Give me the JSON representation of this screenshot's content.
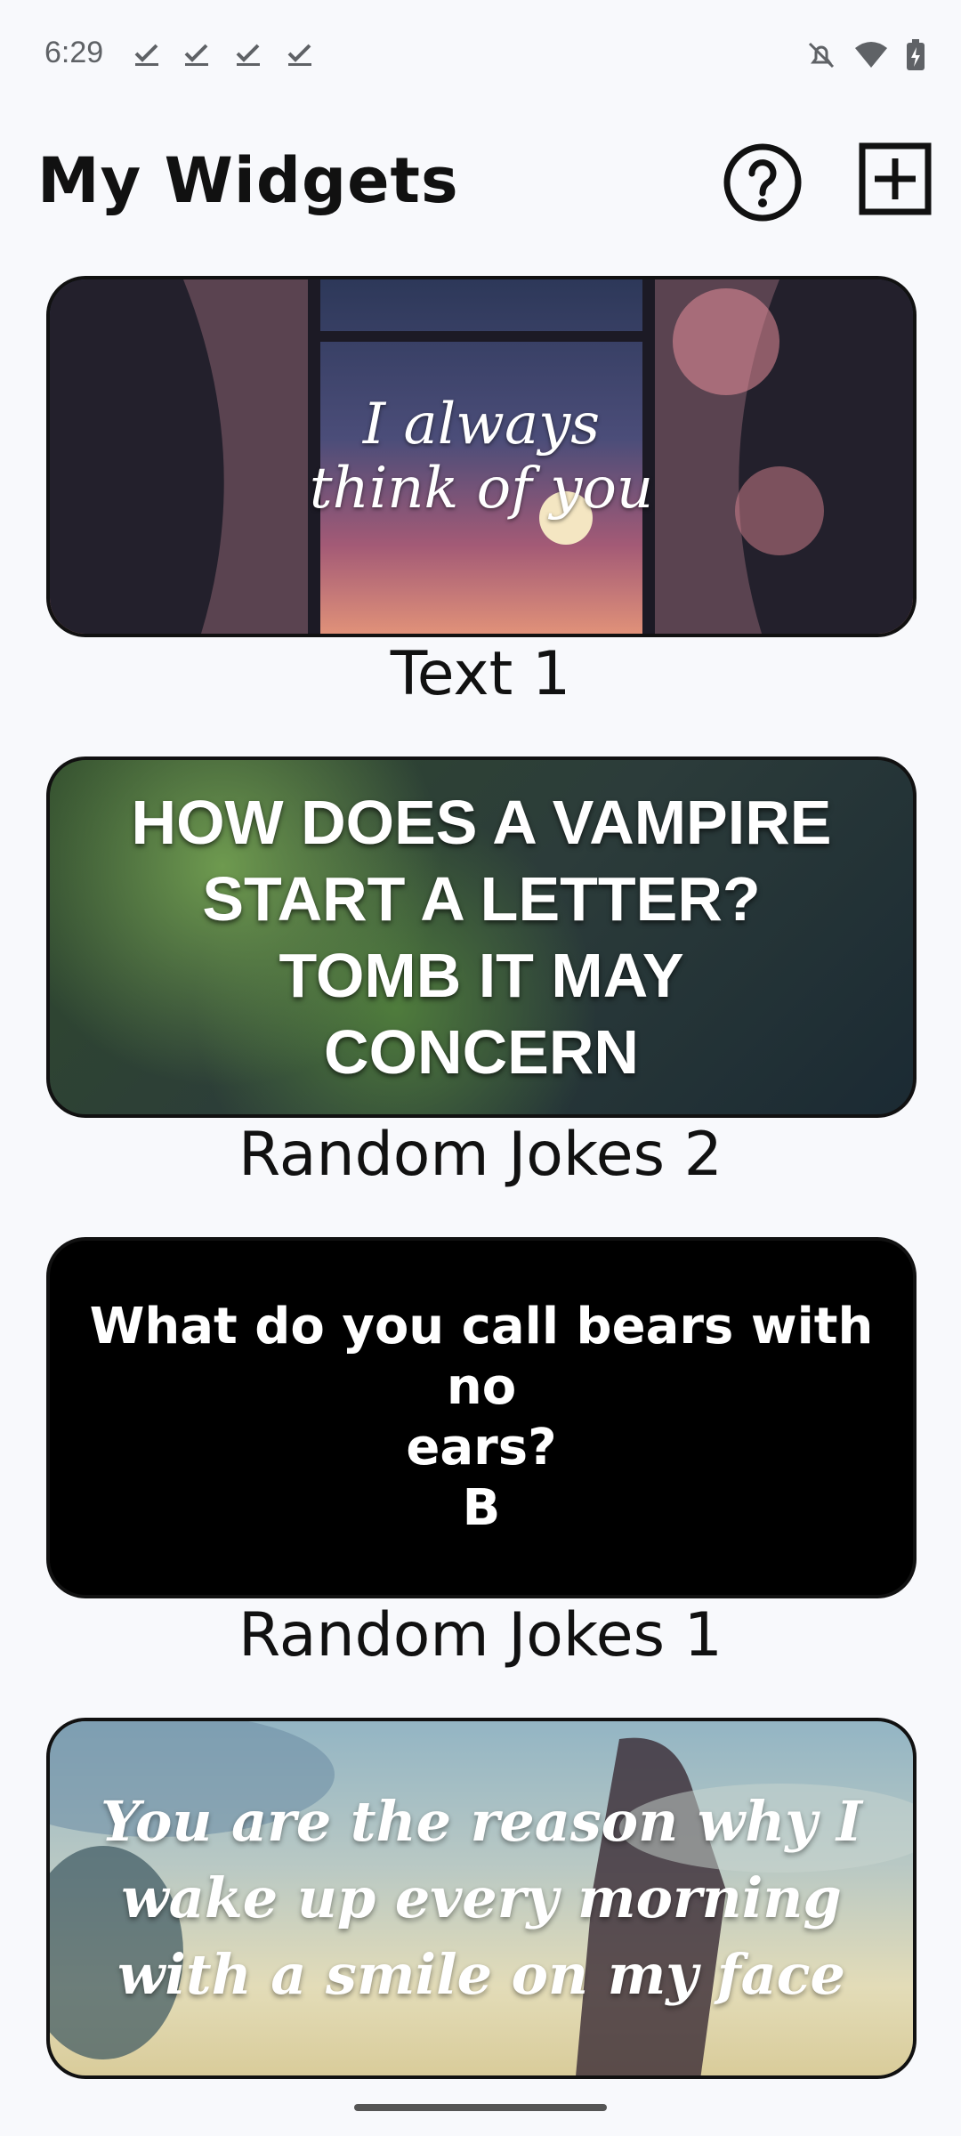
{
  "status_bar": {
    "time": "6:29",
    "notification_icons": [
      "check-icon",
      "check-icon",
      "check-icon",
      "check-icon"
    ],
    "system_icons": [
      "notifications-off-icon",
      "wifi-icon",
      "battery-charging-icon"
    ]
  },
  "header": {
    "title": "My Widgets",
    "actions": [
      "help-icon",
      "add-icon"
    ]
  },
  "widgets": [
    {
      "preview_lines": [
        "I always",
        "think of you"
      ],
      "label": "Text 1"
    },
    {
      "preview_lines": [
        "HOW DOES A VAMPIRE",
        "START A LETTER?",
        "TOMB IT MAY",
        "CONCERN"
      ],
      "label": "Random Jokes 2"
    },
    {
      "preview_lines": [
        "What do you call bears with no",
        "ears?",
        "B"
      ],
      "label": "Random Jokes 1"
    },
    {
      "preview_lines": [
        "You are the reason why I",
        "wake up every morning",
        "with a smile on my face"
      ],
      "label": ""
    }
  ],
  "colors": {
    "background": "#f8f9fc",
    "text": "#111111",
    "card_border": "#111111"
  }
}
